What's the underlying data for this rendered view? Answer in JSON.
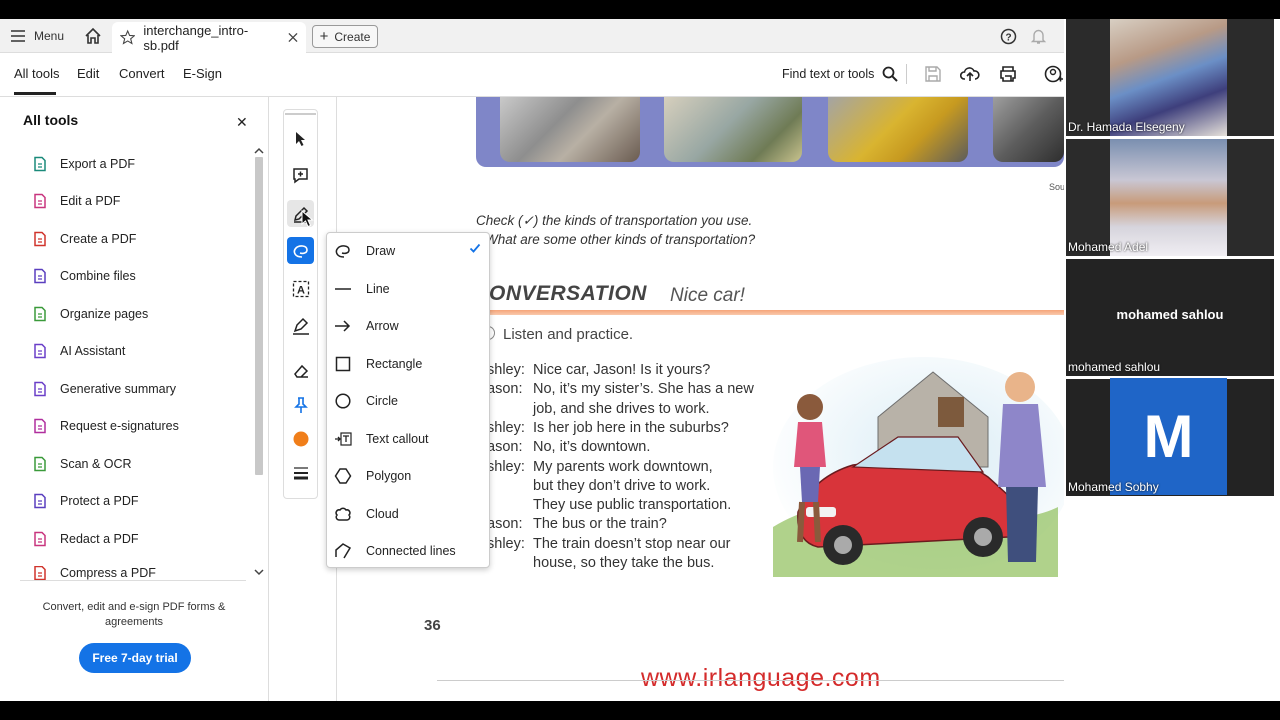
{
  "tabbar": {
    "menu_label": "Menu",
    "tab_title": "interchange_intro-sb.pdf",
    "create_label": "Create"
  },
  "toolbar": {
    "tabs": [
      "All tools",
      "Edit",
      "Convert",
      "E-Sign"
    ],
    "find_label": "Find text or tools"
  },
  "panel": {
    "title": "All tools",
    "items": [
      {
        "label": "Export a PDF",
        "icon": "export-pdf-icon",
        "color": "#1a8a7a"
      },
      {
        "label": "Edit a PDF",
        "icon": "edit-pdf-icon",
        "color": "#c8357e"
      },
      {
        "label": "Create a PDF",
        "icon": "create-pdf-icon",
        "color": "#d0342c"
      },
      {
        "label": "Combine files",
        "icon": "combine-files-icon",
        "color": "#5a3fbf"
      },
      {
        "label": "Organize pages",
        "icon": "organize-pages-icon",
        "color": "#3a9a3a"
      },
      {
        "label": "AI Assistant",
        "icon": "ai-assistant-icon",
        "color": "#6a3fc8"
      },
      {
        "label": "Generative summary",
        "icon": "generative-summary-icon",
        "color": "#6a3fc8"
      },
      {
        "label": "Request e-signatures",
        "icon": "request-esign-icon",
        "color": "#b02f9e"
      },
      {
        "label": "Scan & OCR",
        "icon": "scan-ocr-icon",
        "color": "#3a9a3a"
      },
      {
        "label": "Protect a PDF",
        "icon": "protect-pdf-icon",
        "color": "#5a3fbf"
      },
      {
        "label": "Redact a PDF",
        "icon": "redact-pdf-icon",
        "color": "#c8357e"
      },
      {
        "label": "Compress a PDF",
        "icon": "compress-pdf-icon",
        "color": "#d0342c"
      }
    ],
    "promo_text": "Convert, edit and e-sign PDF forms & agreements",
    "trial_button": "Free 7-day trial"
  },
  "draw_menu": {
    "items": [
      {
        "label": "Draw",
        "icon": "draw-icon",
        "checked": true
      },
      {
        "label": "Line",
        "icon": "line-icon"
      },
      {
        "label": "Arrow",
        "icon": "arrow-icon"
      },
      {
        "label": "Rectangle",
        "icon": "rectangle-icon"
      },
      {
        "label": "Circle",
        "icon": "circle-icon"
      },
      {
        "label": "Text callout",
        "icon": "text-callout-icon"
      },
      {
        "label": "Polygon",
        "icon": "polygon-icon"
      },
      {
        "label": "Cloud",
        "icon": "cloud-icon"
      },
      {
        "label": "Connected lines",
        "icon": "connected-lines-icon"
      }
    ]
  },
  "document": {
    "source": "Sour",
    "check_line1": "Check (✓) the kinds of transportation you use.",
    "check_line2": "What are some other kinds of transportation?",
    "conv_title": "ONVERSATION",
    "conv_sub": "Nice car!",
    "listen": "Listen and practice.",
    "dialogue": [
      {
        "speaker": "shley:",
        "lines": [
          "Nice car, Jason! Is it yours?"
        ]
      },
      {
        "speaker": "ason:",
        "lines": [
          "No, it’s my sister’s. She has a new",
          "job, and she drives to work."
        ]
      },
      {
        "speaker": "shley:",
        "lines": [
          "Is her job here in the suburbs?"
        ]
      },
      {
        "speaker": "ason:",
        "lines": [
          "No, it’s downtown."
        ]
      },
      {
        "speaker": "shley:",
        "lines": [
          "My parents work downtown,",
          "but they don’t drive to work.",
          "They use public transportation."
        ]
      },
      {
        "speaker": "ason:",
        "lines": [
          "The bus or the train?"
        ]
      },
      {
        "speaker": "shley:",
        "lines": [
          "The train doesn’t stop near our",
          "house, so they take the bus."
        ]
      }
    ],
    "page_number": "36",
    "watermark": "www.irlanguage.com"
  },
  "participants": [
    {
      "name": "Dr. Hamada Elsegeny"
    },
    {
      "name": "Mohamed Adel"
    },
    {
      "name": "mohamed sahlou",
      "center_label": "mohamed sahlou"
    },
    {
      "name": "Mohamed Sobhy",
      "initial": "M"
    }
  ],
  "colors": {
    "accent": "#1473e6",
    "photo_strip": "#7f86c8",
    "watermark": "#d42b2b"
  }
}
